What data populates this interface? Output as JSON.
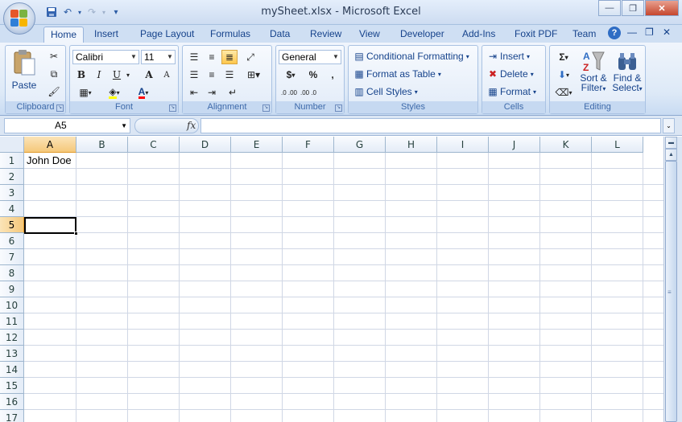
{
  "window": {
    "title": "mySheet.xlsx - Microsoft Excel",
    "controls": {
      "minimize": "—",
      "restore": "❐",
      "close": "✕"
    }
  },
  "qat": {
    "customize": "⚊"
  },
  "tabs": [
    "Home",
    "Insert",
    "Page Layout",
    "Formulas",
    "Data",
    "Review",
    "View",
    "Developer",
    "Add-Ins",
    "Foxit PDF",
    "Team"
  ],
  "active_tab": "Home",
  "ribbon": {
    "clipboard": {
      "label": "Clipboard",
      "paste": "Paste"
    },
    "font": {
      "label": "Font",
      "name": "Calibri",
      "size": "11",
      "bold": "B",
      "italic": "I",
      "underline": "U",
      "grow": "A",
      "shrink": "A",
      "highlight_color": "#ffff00",
      "font_color": "#ff0000"
    },
    "alignment": {
      "label": "Alignment"
    },
    "number": {
      "label": "Number",
      "format": "General",
      "currency": "$",
      "percent": "%",
      "comma": ",",
      "inc_decimal": ".0 .00",
      "dec_decimal": ".00 .0"
    },
    "styles": {
      "label": "Styles",
      "conditional": "Conditional Formatting",
      "format_table": "Format as Table",
      "cell_styles": "Cell Styles"
    },
    "cells": {
      "label": "Cells",
      "insert": "Insert",
      "delete": "Delete",
      "format": "Format"
    },
    "editing": {
      "label": "Editing",
      "sum": "Σ",
      "sort_filter_1": "Sort &",
      "sort_filter_2": "Filter",
      "find_select_1": "Find &",
      "find_select_2": "Select"
    }
  },
  "formula_bar": {
    "name_box": "A5",
    "fx": "fx",
    "formula": ""
  },
  "grid": {
    "columns": [
      "A",
      "B",
      "C",
      "D",
      "E",
      "F",
      "G",
      "H",
      "I",
      "J",
      "K",
      "L"
    ],
    "rows": [
      "1",
      "2",
      "3",
      "4",
      "5",
      "6",
      "7",
      "8",
      "9",
      "10",
      "11",
      "12",
      "13",
      "14",
      "15",
      "16",
      "17"
    ],
    "selected_column": "A",
    "selected_row": "5",
    "cells": {
      "A1": "John Doe"
    }
  },
  "accent_colors": {
    "selected_header": "#f5c87a",
    "ribbon": "#dde9f7"
  }
}
